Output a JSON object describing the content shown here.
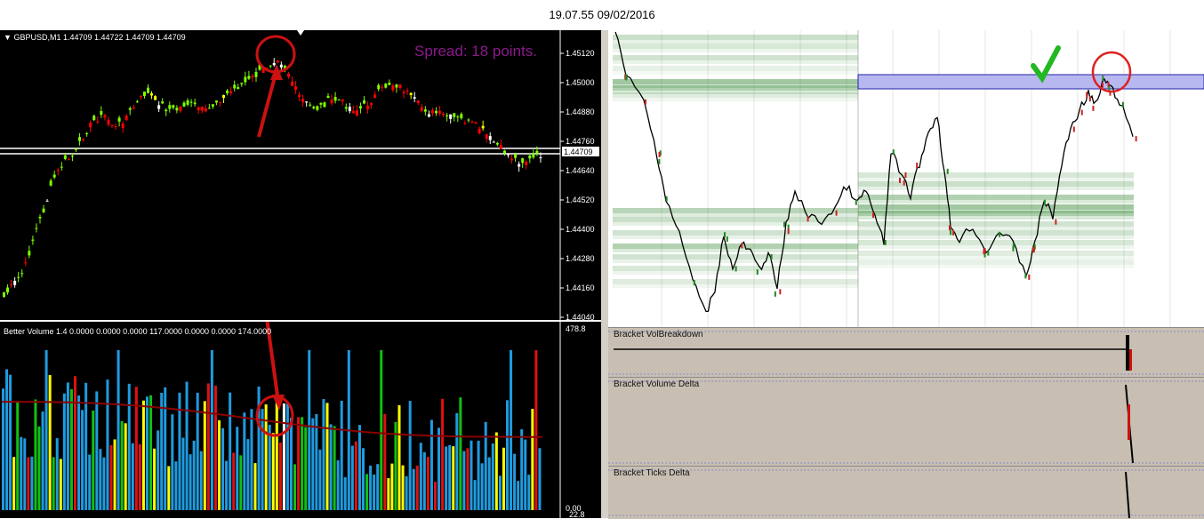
{
  "header": {
    "timestamp": "19.07.55 09/02/2016"
  },
  "mt4": {
    "symbol_line": "GBPUSD,M1  1.44709 1.44722 1.44709 1.44709",
    "spread_text": "Spread: 18 points.",
    "price_axis": [
      "1.45120",
      "1.45000",
      "1.44880",
      "1.44760",
      "1.44640",
      "1.44520",
      "1.44400",
      "1.44280",
      "1.44160",
      "1.44040"
    ],
    "last_price": "1.44709",
    "volume_title": "Better Volume 1.4  0.0000  0.0000  0.0000  117.0000  0.0000  0.0000  174.0000",
    "volume_axis_top": "478.8",
    "volume_axis_bottom": "0.00",
    "volume_axis_bottom2": "22.8",
    "colors": {
      "bull": "#7fff00",
      "bear": "#ff0000",
      "vol_blue": "#1e9be0",
      "vol_red": "#e01010",
      "vol_yellow": "#ffff00",
      "vol_green": "#10c010",
      "vol_white": "#ffffff",
      "ma": "#8b0000",
      "annotation": "#cc1111"
    }
  },
  "nt": {
    "indicators": [
      {
        "label": "Bracket VolBreakdown"
      },
      {
        "label": "Bracket Volume Delta"
      },
      {
        "label": "Bracket Ticks Delta"
      }
    ],
    "colors": {
      "zone": "#b8b8f0",
      "zone_border": "#2222aa",
      "check": "#22b822",
      "circle": "#dd2222"
    }
  }
}
